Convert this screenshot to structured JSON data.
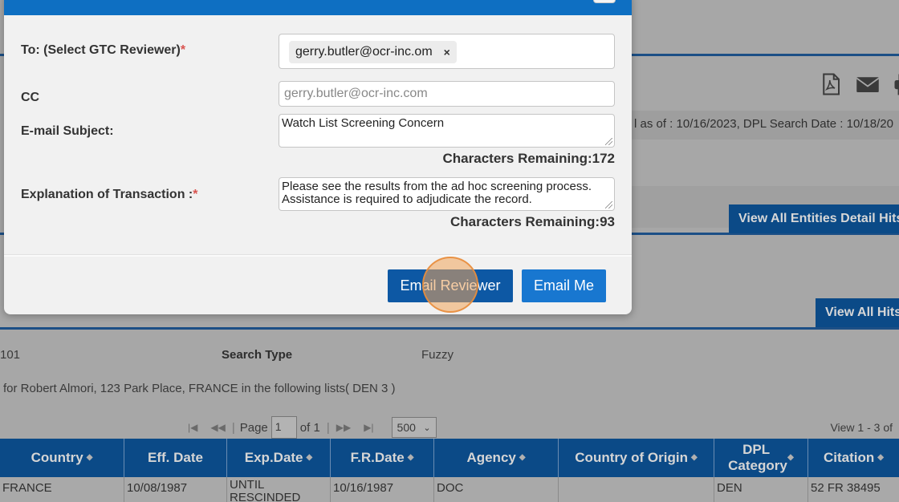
{
  "background": {
    "info_text": "l as of : 10/16/2023,  DPL Search Date : 10/18/20",
    "view_all_entities_btn": "View All Entities Detail Hits",
    "view_all_hits_btn": "View All Hits",
    "row_number": "101",
    "search_type_label": "Search Type",
    "search_type_value": "Fuzzy",
    "results_text": "for  Robert Almori, 123 Park Place, FRANCE  in the following lists( DEN 3 )",
    "pager": {
      "page_label": "Page",
      "page_value": "1",
      "of_label": "of 1",
      "rows_per_page": "500",
      "view_text": "View 1 - 3 of"
    },
    "grid": {
      "columns": [
        "Country",
        "Eff. Date",
        "Exp.Date",
        "F.R.Date",
        "Agency",
        "Country of Origin",
        "DPL Category",
        "Citation"
      ],
      "rows": [
        [
          "FRANCE",
          "10/08/1987",
          "UNTIL RESCINDED",
          "10/16/1987",
          "DOC",
          "",
          "DEN",
          "52 FR 38495"
        ]
      ]
    }
  },
  "modal": {
    "to_label": "To: (Select GTC Reviewer)",
    "to_chip": "gerry.butler@ocr-inc.om",
    "cc_label": "CC",
    "cc_placeholder": "gerry.butler@ocr-inc.com",
    "subject_label": "E-mail Subject:",
    "subject_value": "Watch List Screening Concern",
    "subject_counter": "Characters Remaining:172",
    "explanation_label": "Explanation of Transaction :",
    "explanation_value": "Please see the results from the ad hoc screening process. Assistance is required to adjudicate the record.",
    "explanation_counter": "Characters Remaining:93",
    "required_mark": "*",
    "chip_remove": "×",
    "email_reviewer_btn": "Email Reviewer",
    "email_me_btn": "Email Me"
  },
  "icons": [
    "pdf-icon",
    "mail-icon",
    "print-icon",
    "sort-arrow-icon",
    "first-page-icon",
    "prev-page-icon",
    "next-page-icon",
    "last-page-icon",
    "chevron-down-icon",
    "close-icon",
    "resize-grip-icon"
  ]
}
